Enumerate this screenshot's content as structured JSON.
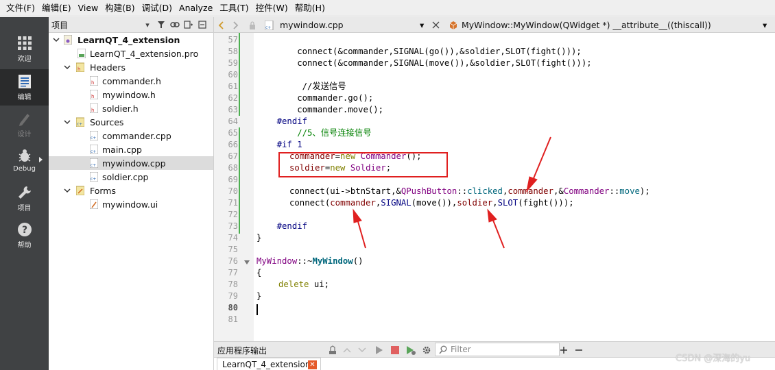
{
  "menu": [
    "文件(F)",
    "编辑(E)",
    "View",
    "构建(B)",
    "调试(D)",
    "Analyze",
    "工具(T)",
    "控件(W)",
    "帮助(H)"
  ],
  "modes": [
    {
      "label": "欢迎",
      "icon": "grid-icon"
    },
    {
      "label": "编辑",
      "icon": "edit-document-icon",
      "active": true
    },
    {
      "label": "设计",
      "icon": "pencil-icon",
      "disabled": true
    },
    {
      "label": "Debug",
      "icon": "bug-icon"
    },
    {
      "label": "项目",
      "icon": "wrench-icon"
    },
    {
      "label": "帮助",
      "icon": "help-icon"
    }
  ],
  "project_panel": {
    "title": "项目",
    "tree": [
      {
        "label": "LearnQT_4_extension",
        "kind": "project",
        "bold": true
      },
      {
        "label": "LearnQT_4_extension.pro",
        "kind": "pro-file"
      },
      {
        "label": "Headers",
        "kind": "folder"
      },
      {
        "label": "commander.h",
        "kind": "header"
      },
      {
        "label": "mywindow.h",
        "kind": "header"
      },
      {
        "label": "soldier.h",
        "kind": "header"
      },
      {
        "label": "Sources",
        "kind": "folder"
      },
      {
        "label": "commander.cpp",
        "kind": "source"
      },
      {
        "label": "main.cpp",
        "kind": "source"
      },
      {
        "label": "mywindow.cpp",
        "kind": "source",
        "selected": true
      },
      {
        "label": "soldier.cpp",
        "kind": "source"
      },
      {
        "label": "Forms",
        "kind": "folder"
      },
      {
        "label": "mywindow.ui",
        "kind": "form"
      }
    ]
  },
  "editor": {
    "file_name": "mywindow.cpp",
    "symbol": "MyWindow::MyWindow(QWidget *) __attribute__((thiscall))",
    "line_numbers": [
      "57",
      "58",
      "59",
      "60",
      "61",
      "62",
      "63",
      "64",
      "65",
      "66",
      "67",
      "68",
      "69",
      "70",
      "71",
      "72",
      "73",
      "74",
      "75",
      "76",
      "77",
      "78",
      "79",
      "80",
      "81"
    ],
    "current_line": "80",
    "code": {
      "l58_a": "        connect(&commander,SIGNAL(go()),&soldier,SLOT(fight()));",
      "l59_a": "        connect(&commander,SIGNAL(move()),&soldier,SLOT(fight()));",
      "l61_a": "         //发送信号",
      "l62_a": "        commander.go();",
      "l63_a": "        commander.move();",
      "l64_a": "    #endif",
      "l65_a": "        //5、信号连接信号",
      "l66_a": "    #if 1",
      "l67_var": "commander",
      "l67_eq": "=",
      "l67_new": "new",
      "l67_type": "Commander",
      "l67_end": "();",
      "l68_var": "soldier",
      "l68_eq": "=",
      "l68_new": "new",
      "l68_type": "Soldier",
      "l68_end": ";",
      "l70_a": "connect(ui->btnStart,&",
      "l70_type": "QPushButton",
      "l70_b": "::",
      "l70_fn": "clicked",
      "l70_c": ",",
      "l70_var": "commander",
      "l70_d": ",&",
      "l70_type2": "Commander",
      "l70_e": "::",
      "l70_fn2": "move",
      "l70_f": ");",
      "l71_a": "connect(",
      "l71_var": "commander",
      "l71_b": ",",
      "l71_mac": "SIGNAL",
      "l71_c": "(move()),",
      "l71_var2": "soldier",
      "l71_d": ",",
      "l71_mac2": "SLOT",
      "l71_e": "(fight()));",
      "l73_a": "    #endif",
      "l74_a": "}",
      "l76_cls": "MyWindow",
      "l76_b": "::~",
      "l76_fn": "MyWindow",
      "l76_c": "()",
      "l77_a": "{",
      "l78_kw": "delete",
      "l78_b": " ui;",
      "l79_a": "}"
    }
  },
  "output": {
    "title": "应用程序输出",
    "filter_placeholder": "Filter",
    "tab_label": "LearnQT_4_extension",
    "tab_close": "✕"
  },
  "watermark": "CSDN @深海的yu",
  "colors": {
    "highlight_box": "#e02020",
    "arrow": "#e02020",
    "modebar": "#404244",
    "changebar": "#4caf50"
  }
}
